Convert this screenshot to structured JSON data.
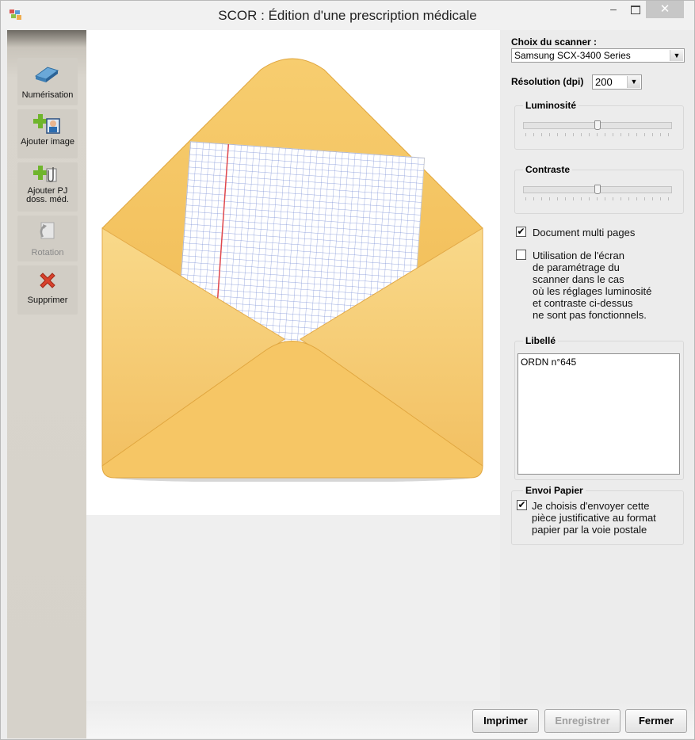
{
  "window": {
    "title": "SCOR : Édition d'une prescription médicale",
    "minimize_glyph": "–",
    "close_glyph": "✕"
  },
  "toolbar": {
    "items": [
      {
        "label": "Numérisation",
        "icon": "scanner-icon",
        "enabled": true
      },
      {
        "label": "Ajouter image",
        "icon": "add-image-icon",
        "enabled": true
      },
      {
        "label": "Ajouter PJ doss. méd.",
        "icon": "add-attachment-icon",
        "enabled": true
      },
      {
        "label": "Rotation",
        "icon": "rotation-icon",
        "enabled": false
      },
      {
        "label": "Supprimer",
        "icon": "delete-icon",
        "enabled": true
      }
    ]
  },
  "preview": {
    "image": "envelope-icon"
  },
  "settings": {
    "scanner_label": "Choix du scanner :",
    "scanner_value": "Samsung SCX-3400 Series",
    "resolution_label": "Résolution (dpi)",
    "resolution_value": "200",
    "luminosity_label": "Luminosité",
    "luminosity_level": 0.5,
    "contrast_label": "Contraste",
    "contrast_level": 0.5,
    "multipage_label": "Document multi pages",
    "multipage_checked": true,
    "screen_settings_label": "Utilisation de l'écran\nde paramétrage du\nscanner dans le cas\noù les réglages luminosité\net contraste ci-dessus\nne sont pas fonctionnels.",
    "screen_settings_checked": false,
    "libelle_label": "Libellé",
    "libelle_value": "ORDN n°645",
    "envoi_label": "Envoi Papier",
    "envoi_text": "Je choisis d'envoyer cette\npièce justificative au format\npapier par la voie postale",
    "envoi_checked": true
  },
  "buttons": {
    "print": "Imprimer",
    "save": "Enregistrer",
    "close": "Fermer"
  },
  "colors": {
    "delete_icon": "#d8412c",
    "add_icon": "#6fb52c",
    "envelope": "#f6c665"
  }
}
